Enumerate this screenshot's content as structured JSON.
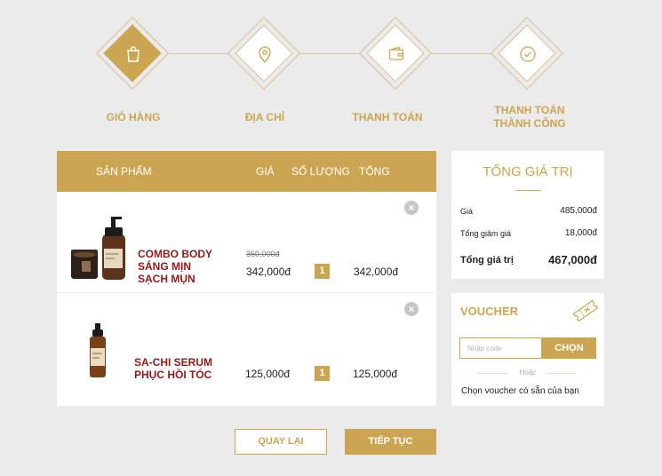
{
  "steps": [
    {
      "label": "GIỎ HÀNG",
      "icon": "shopping-bag-icon",
      "active": true
    },
    {
      "label": "ĐỊA CHỈ",
      "icon": "location-pin-icon",
      "active": false
    },
    {
      "label": "THANH TOÁN",
      "icon": "wallet-icon",
      "active": false
    },
    {
      "label": "THANH TOÁN\nTHÀNH CÔNG",
      "label_line1": "THANH TOÁN",
      "label_line2": "THÀNH CÔNG",
      "icon": "check-circle-icon",
      "active": false
    }
  ],
  "cart": {
    "headers": {
      "product": "SẢN PHẨM",
      "price": "GIÁ",
      "quantity": "SỐ LƯỢNG",
      "total": "TỔNG"
    },
    "items": [
      {
        "name_line1": "COMBO BODY",
        "name_line2": "SÁNG MỊN",
        "name_line3": "SẠCH MỤN",
        "old_price": "360,000đ",
        "price": "342,000đ",
        "quantity": "1",
        "total": "342,000đ",
        "remove": "×"
      },
      {
        "name_line1": "SA-CHI SERUM",
        "name_line2": "PHỤC HỒI TÓC",
        "price": "125,000đ",
        "quantity": "1",
        "total": "125,000đ",
        "remove": "×"
      }
    ]
  },
  "summary": {
    "title": "TỔNG GIÁ TRỊ",
    "price_label": "Giá",
    "price_value": "485,000đ",
    "discount_label": "Tổng giảm giá",
    "discount_value": "18,000đ",
    "total_label": "Tổng giá trị",
    "total_value": "467,000đ"
  },
  "voucher": {
    "title": "VOUCHER",
    "placeholder": "Nhập code",
    "button": "CHỌN",
    "or": "Hoặc",
    "hint": "Chọn voucher có sẵn của bạn"
  },
  "buttons": {
    "back": "QUAY LẠI",
    "next": "TIẾP TỤC"
  },
  "colors": {
    "accent": "#cba552",
    "product_name": "#8e1a1a",
    "background": "#ebebeb"
  }
}
